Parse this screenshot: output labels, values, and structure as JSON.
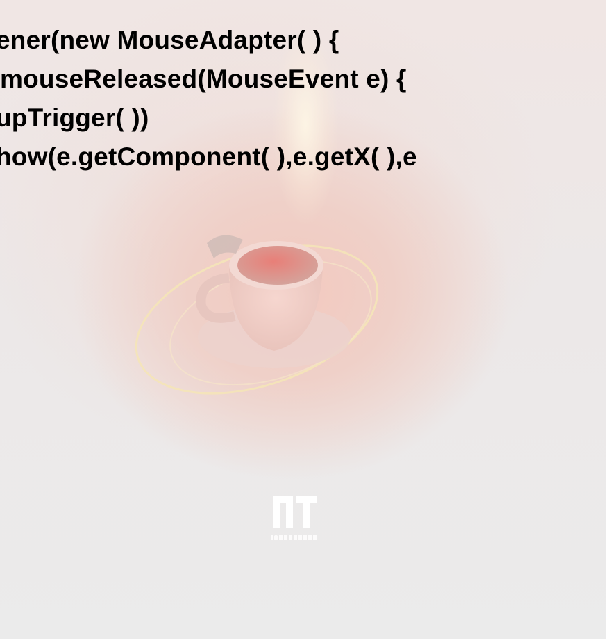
{
  "code": {
    "lines": [
      "ener(new MouseAdapter( ) {",
      " mouseReleased(MouseEvent e) {",
      "upTrigger( ))",
      "how(e.getComponent( ),e.getX( ),e"
    ]
  },
  "logo": {
    "text": "NOVATERRA",
    "icon": "nt-monogram-logo"
  },
  "background": {
    "icon": "coffee-cup-illustration",
    "accent": "#e8a090"
  }
}
